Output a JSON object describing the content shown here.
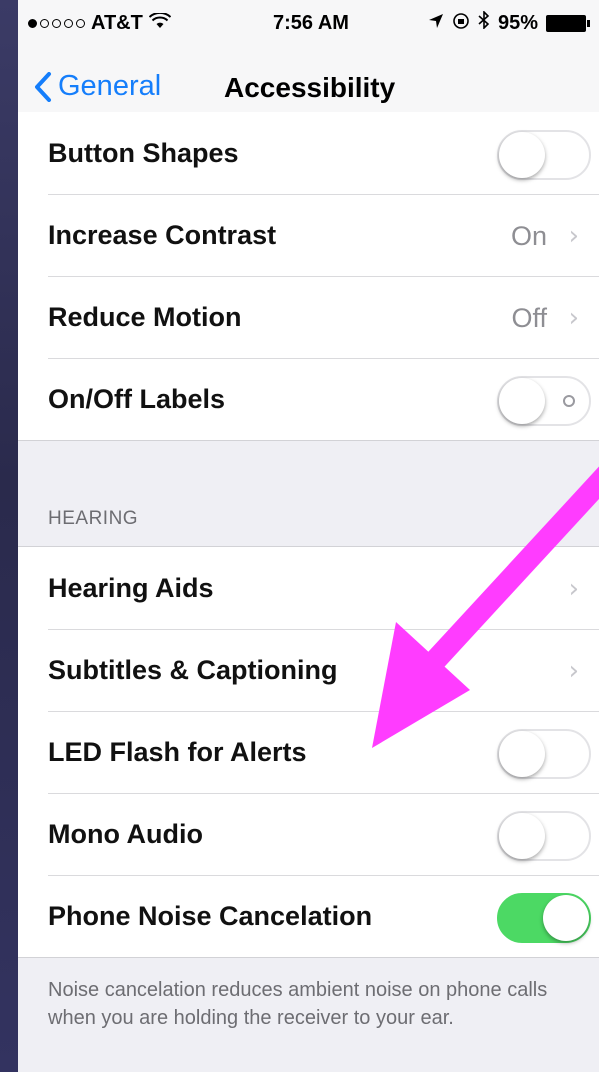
{
  "status_bar": {
    "carrier": "AT&T",
    "time": "7:56 AM",
    "battery": "95%"
  },
  "nav": {
    "back_label": "General",
    "title": "Accessibility"
  },
  "vision_rows": [
    {
      "label": "Button Shapes",
      "control": "toggle",
      "state": "off"
    },
    {
      "label": "Increase Contrast",
      "value": "On"
    },
    {
      "label": "Reduce Motion",
      "value": "Off"
    },
    {
      "label": "On/Off Labels",
      "control": "toggle",
      "state": "off"
    }
  ],
  "hearing": {
    "header": "HEARING",
    "rows": [
      {
        "label": "Hearing Aids"
      },
      {
        "label": "Subtitles & Captioning"
      },
      {
        "label": "LED Flash for Alerts",
        "control": "toggle",
        "state": "off"
      },
      {
        "label": "Mono Audio",
        "control": "toggle",
        "state": "off"
      },
      {
        "label": "Phone Noise Cancelation",
        "control": "toggle",
        "state": "on"
      }
    ],
    "footer": "Noise cancelation reduces ambient noise on phone calls when you are holding the receiver to your ear."
  },
  "colors": {
    "accent": "#157efb",
    "toggle_on": "#4cd964",
    "annotation_arrow": "#ff3cff"
  },
  "icons": [
    "wifi-icon",
    "location-arrow-icon",
    "lock-rotation-icon",
    "bluetooth-icon",
    "battery-icon",
    "back-chevron-icon",
    "chevron-right-icon"
  ]
}
